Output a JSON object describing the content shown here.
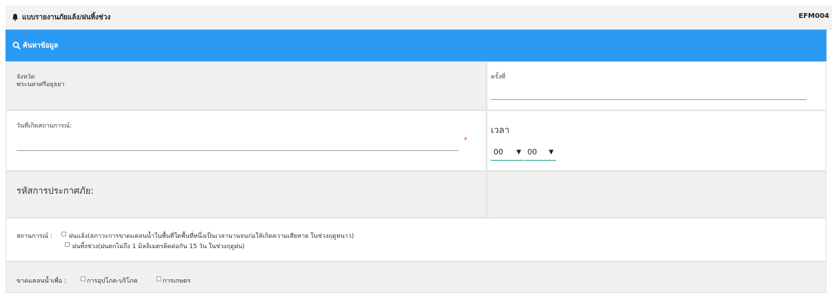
{
  "header": {
    "title": "แบบรายงานภัยแล้ง/ฝนทิ้งช่วง",
    "form_code": "EFM004"
  },
  "search": {
    "label": "ค้นหาข้อมูล"
  },
  "province": {
    "label": "จังหวัด",
    "value": "พระนครศรีอยุธยา"
  },
  "round": {
    "label": "ครั้งที่",
    "value": ""
  },
  "event_date": {
    "label": "วันที่เกิดสถานการณ์:",
    "value": "",
    "required_mark": "*"
  },
  "time": {
    "label": "เวลา",
    "hour": "00",
    "minute": "00"
  },
  "disaster_code": {
    "label": "รหัสการประกาศภัย:"
  },
  "situation": {
    "label": "สถานการณ์ :",
    "options": [
      "ฝนแล้ง(สภาวะการขาดแคลนน้ำในพื้นที่ใดพื้นที่หนึ่งเป็นเวลานานจนก่อให้เกิดความเสียหาย ในช่วงฤดูหนาว)",
      "ฝนทิ้งช่วง(ฝนตกไม่ถึง 1 มิลลิเมตรติดต่อกัน 15 วัน ในช่วงฤดูฝน)"
    ]
  },
  "shortage": {
    "label": "ขาดแคลนน้ำเพื่อ :",
    "options": [
      "การอุปโภค-บริโภค",
      "การเกษตร"
    ]
  },
  "colors": {
    "accent_blue": "#2b9af3",
    "underline_teal": "#1f9c8a",
    "required_red": "#e53935"
  }
}
